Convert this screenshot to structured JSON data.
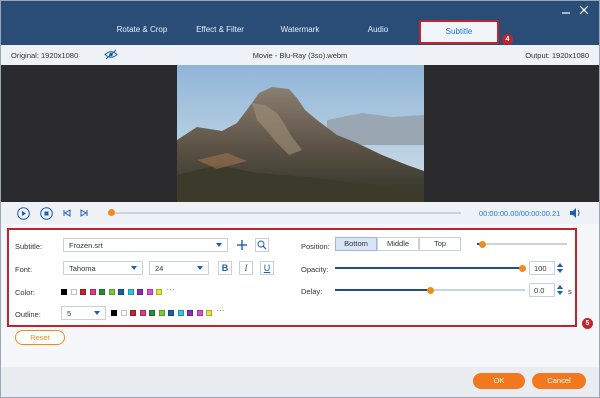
{
  "tabs": [
    {
      "label": "Rotate & Crop"
    },
    {
      "label": "Effect & Filter"
    },
    {
      "label": "Watermark"
    },
    {
      "label": "Audio"
    },
    {
      "label": "Subtitle"
    }
  ],
  "markers": {
    "subtitle_tab": "4",
    "panel": "5"
  },
  "info": {
    "original": "Original: 1920x1080",
    "filename": "Movie - Blu-Ray (3so).webm",
    "output": "Output: 1920x1080"
  },
  "player": {
    "time": "00:00:00.00/00:00:00.21"
  },
  "subtitle_form": {
    "subtitle_label": "Subtitle:",
    "subtitle_file": "Frozen.srt",
    "font_label": "Font:",
    "font_name": "Tahoma",
    "font_size": "24",
    "bold": "B",
    "italic": "I",
    "underline": "U",
    "color_label": "Color:",
    "outline_label": "Outline:",
    "outline_value": "5",
    "position_label": "Position:",
    "positions": [
      "Bottom",
      "Middle",
      "Top"
    ],
    "position_selected": "Bottom",
    "opacity_label": "Opacity:",
    "opacity_value": "100",
    "delay_label": "Delay:",
    "delay_value": "0.0",
    "delay_unit": "s",
    "more": "···"
  },
  "colors": [
    "#000000",
    "#ffffff",
    "#c0242c",
    "#e23a7c",
    "#2e8a3c",
    "#7ecb3a",
    "#1e5eb0",
    "#34c3e0",
    "#8a2dbb",
    "#e04bd0",
    "#e8e337"
  ],
  "buttons": {
    "reset": "Reset",
    "ok": "OK",
    "cancel": "Cancel"
  },
  "accent": "#f28a1b",
  "highlight": "#c0242c"
}
